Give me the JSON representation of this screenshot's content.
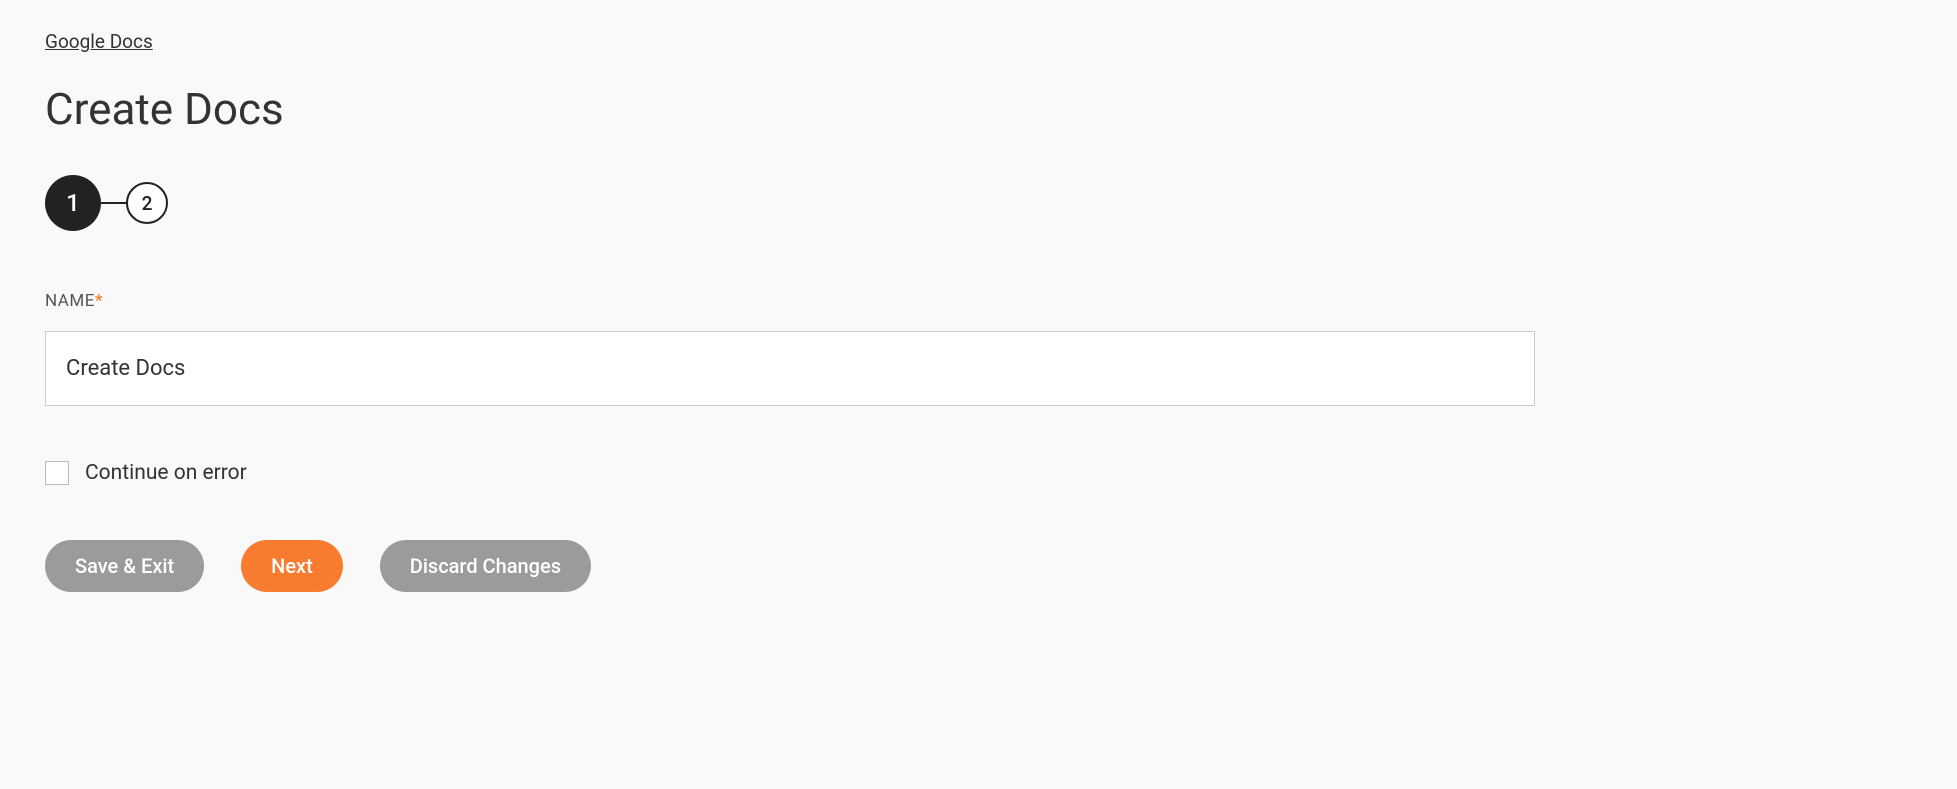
{
  "breadcrumb": "Google Docs",
  "page_title": "Create Docs",
  "stepper": {
    "steps": [
      "1",
      "2"
    ],
    "active_index": 0
  },
  "form": {
    "name_label": "NAME",
    "required_marker": "*",
    "name_value": "Create Docs",
    "continue_on_error_label": "Continue on error",
    "continue_on_error_checked": false
  },
  "buttons": {
    "save_exit": "Save & Exit",
    "next": "Next",
    "discard": "Discard Changes"
  }
}
